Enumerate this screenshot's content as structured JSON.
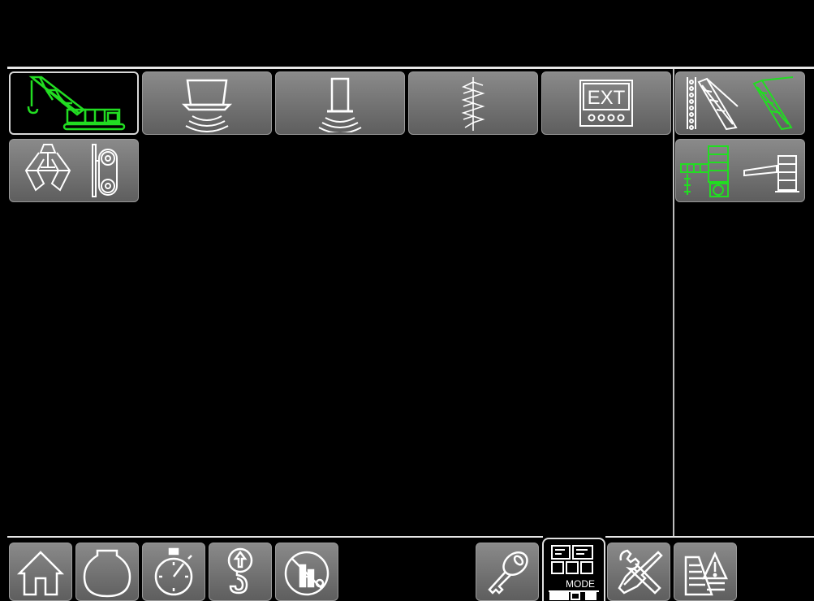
{
  "screen": {
    "accent_green": "#22dd22",
    "frame_gray": "#e6e6e6"
  },
  "modes": {
    "crane_label": "crane-mode",
    "ext_label": "EXT"
  },
  "mode_button": {
    "label": "MODE"
  },
  "icons": [
    "crawler-crane-icon",
    "slurry-wall-grab-icon",
    "diaphragm-wall-icon",
    "auger-drill-icon",
    "ext-panel-icon",
    "boom-config-icon",
    "counterweight-config-icon",
    "clamshell-grab-icon",
    "winch-drum-icon",
    "home-icon",
    "engine-icon",
    "stopwatch-icon",
    "hook-icon",
    "lift-limit-disabled-icon",
    "key-icon",
    "mode-icon",
    "tools-icon",
    "warning-list-icon"
  ]
}
